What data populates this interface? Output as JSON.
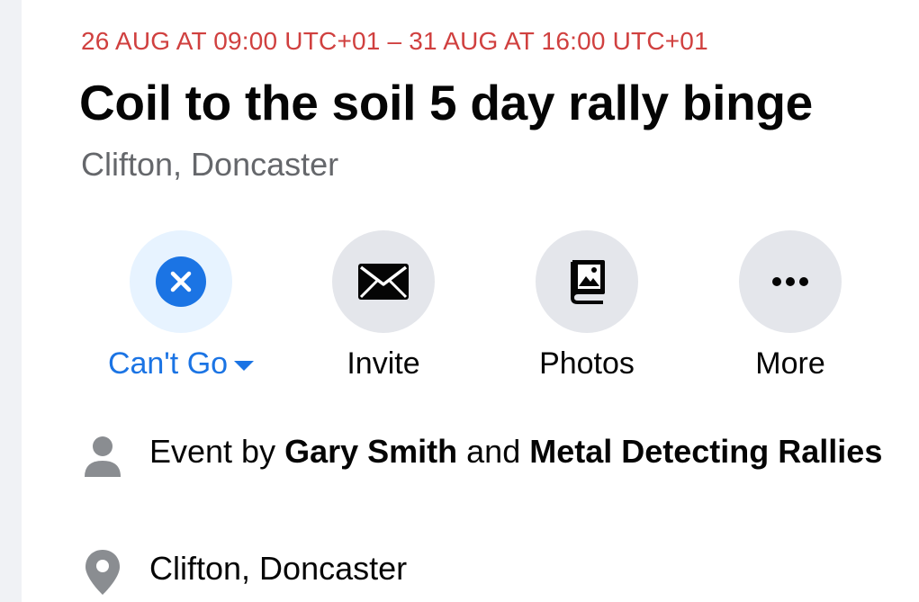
{
  "event": {
    "date_range": "26 AUG AT 09:00 UTC+01 – 31 AUG AT 16:00 UTC+01",
    "title": "Coil to the soil 5 day rally binge",
    "location_subtitle": "Clifton, Doncaster"
  },
  "actions": [
    {
      "label": "Can't Go",
      "icon": "close-circle-icon",
      "active": true
    },
    {
      "label": "Invite",
      "icon": "envelope-icon"
    },
    {
      "label": "Photos",
      "icon": "photo-book-icon"
    },
    {
      "label": "More",
      "icon": "more-dots-icon"
    }
  ],
  "details": {
    "host_prefix": "Event by ",
    "host_1": "Gary Smith",
    "host_joiner": " and ",
    "host_2": "Metal Detecting Rallies",
    "host_icon": "person-icon",
    "location": "Clifton, Doncaster",
    "location_icon": "location-pin-icon"
  },
  "colors": {
    "date_red": "#d0403f",
    "accent_blue": "#1b74e4",
    "muted_gray": "#65676b",
    "button_gray": "#e4e6eb",
    "active_bg": "#e7f3ff"
  }
}
